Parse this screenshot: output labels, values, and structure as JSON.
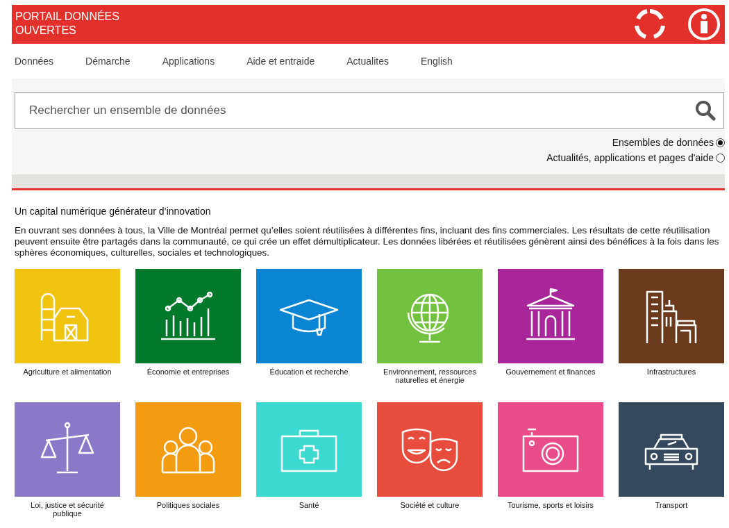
{
  "header": {
    "title": "PORTAIL DONNÉES OUVERTES"
  },
  "nav": [
    {
      "label": "Données"
    },
    {
      "label": "Démarche"
    },
    {
      "label": "Applications"
    },
    {
      "label": "Aide et entraide"
    },
    {
      "label": "Actualites"
    },
    {
      "label": "English"
    }
  ],
  "search": {
    "placeholder": "Rechercher un ensemble de données"
  },
  "scopes": [
    {
      "label": "Ensembles de données",
      "selected": true
    },
    {
      "label": "Actualités, applications et pages d'aide",
      "selected": false
    }
  ],
  "intro": {
    "heading": "Un capital numérique générateur d’innovation",
    "text": "En ouvrant ses données à tous, la Ville de Montréal permet qu’elles soient réutilisées à différentes fins, incluant des fins commerciales. Les résultats de cette réutilisation peuvent ensuite être partagés dans la communauté, ce qui crée un effet démultiplicateur. Les données libérées et réutilisées génèrent ainsi des bénéfices à la fois dans les sphères économiques, culturelles, sociales et technologiques."
  },
  "categories": [
    {
      "label": "Agriculture et alimentation",
      "color": "#f0c30f",
      "kind": "barn"
    },
    {
      "label": "Économie et entreprises",
      "color": "#007a2a",
      "kind": "chart"
    },
    {
      "label": "Éducation et recherche",
      "color": "#0a85d4",
      "kind": "cap"
    },
    {
      "label": "Environnement, ressources naturelles et énergie",
      "color": "#72c23f",
      "kind": "globe"
    },
    {
      "label": "Gouvernement et finances",
      "color": "#a8259a",
      "kind": "building"
    },
    {
      "label": "Infrastructures",
      "color": "#6b3a1c",
      "kind": "city"
    },
    {
      "label": "Loi, justice et sécurité publique",
      "color": "#8b78c8",
      "kind": "scale"
    },
    {
      "label": "Politiques sociales",
      "color": "#f39c12",
      "kind": "people"
    },
    {
      "label": "Santé",
      "color": "#3bd9d0",
      "kind": "kit"
    },
    {
      "label": "Société et culture",
      "color": "#e84c3d",
      "kind": "masks"
    },
    {
      "label": "Tourisme, sports et loisirs",
      "color": "#ea4c89",
      "kind": "camera"
    },
    {
      "label": "Transport",
      "color": "#34495e",
      "kind": "car"
    }
  ]
}
